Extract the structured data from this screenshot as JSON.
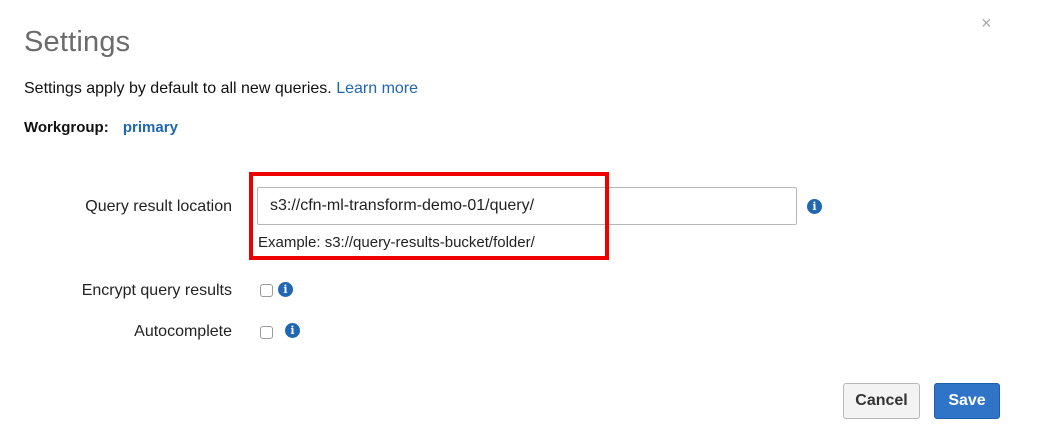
{
  "dialog": {
    "title": "Settings",
    "close_glyph": "×",
    "intro_text": "Settings apply by default to all new queries.",
    "learn_more": "Learn more"
  },
  "workgroup": {
    "label": "Workgroup:",
    "value": "primary"
  },
  "form": {
    "query_result_location": {
      "label": "Query result location",
      "value": "s3://cfn-ml-transform-demo-01/query/",
      "example": "Example: s3://query-results-bucket/folder/"
    },
    "encrypt": {
      "label": "Encrypt query results",
      "checked": false
    },
    "autocomplete": {
      "label": "Autocomplete",
      "checked": false
    }
  },
  "icons": {
    "info": "i"
  },
  "buttons": {
    "cancel": "Cancel",
    "save": "Save"
  },
  "colors": {
    "link": "#1f66b3",
    "highlight": "#ee0000",
    "save_button": "#2f74c6"
  }
}
